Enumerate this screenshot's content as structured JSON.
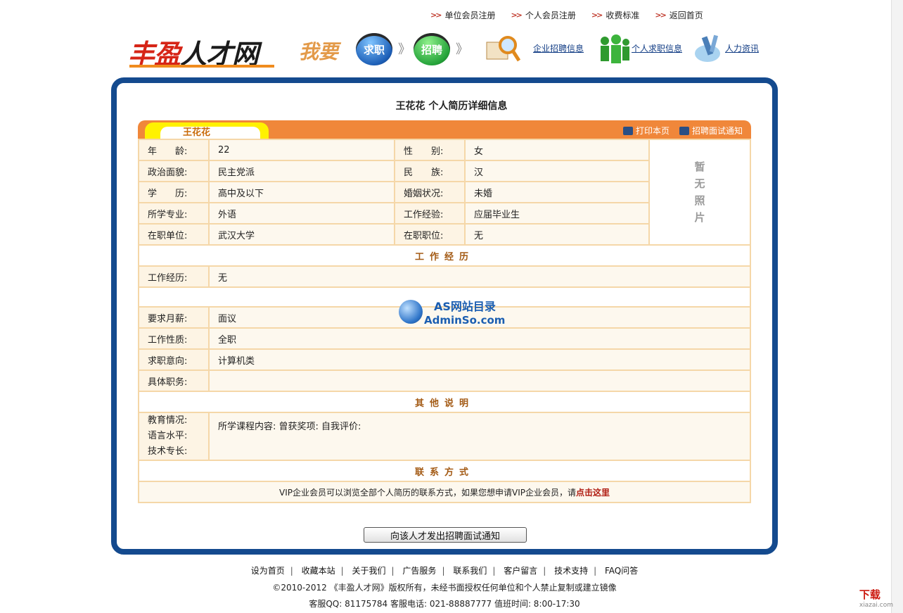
{
  "top_nav": [
    "单位会员注册",
    "个人会员注册",
    "收费标准",
    "返回首页"
  ],
  "logo": {
    "part1": "丰盈",
    "part2": "人才网"
  },
  "header": {
    "woyao": "我要",
    "qiuzhi": "求职",
    "zhaopin": "招聘",
    "links": [
      "企业招聘信息",
      "个人求职信息",
      "人力资讯"
    ]
  },
  "page_title": "王花花  个人简历详细信息",
  "resume": {
    "name_tab": "王花花",
    "print_label": "打印本页",
    "notify_label": "招聘面试通知",
    "basic": [
      {
        "l1": "年　　龄:",
        "v1": "22",
        "l2": "性　　别:",
        "v2": "女"
      },
      {
        "l1": "政治面貌:",
        "v1": "民主党派",
        "l2": "民　　族:",
        "v2": "汉"
      },
      {
        "l1": "学　　历:",
        "v1": "高中及以下",
        "l2": "婚姻状况:",
        "v2": "未婚"
      },
      {
        "l1": "所学专业:",
        "v1": "外语",
        "l2": "工作经验:",
        "v2": "应届毕业生"
      },
      {
        "l1": "在职单位:",
        "v1": "武汉大学",
        "l2": "在职职位:",
        "v2": "无"
      }
    ],
    "photo_text": [
      "暂",
      "无",
      "照",
      "片"
    ],
    "section_work": "工作经历",
    "work_label": "工作经历:",
    "work_value": "无",
    "job": [
      {
        "label": "要求月薪:",
        "value": "面议"
      },
      {
        "label": "工作性质:",
        "value": "全职"
      },
      {
        "label": "求职意向:",
        "value": "计算机类"
      },
      {
        "label": "具体职务:",
        "value": ""
      }
    ],
    "section_other": "其他说明",
    "other_labels": [
      "教育情况:",
      "语言水平:",
      "技术专长:"
    ],
    "other_value": "所学课程内容: 曾获奖项: 自我评价:",
    "section_contact": "联系方式",
    "contact_note": "VIP企业会员可以浏览全部个人简历的联系方式，如果您想申请VIP企业会员，请",
    "contact_link": "点击这里"
  },
  "watermark": {
    "line1": "AS网站目录",
    "line2": "AdminSo.com"
  },
  "send_button": "向该人才发出招聘面试通知",
  "footer": {
    "links": [
      "设为首页",
      "收藏本站",
      "关于我们",
      "广告服务",
      "联系我们",
      "客户留言",
      "技术支持",
      "FAQ问答"
    ],
    "copyright": "©2010-2012 《丰盈人才网》版权所有，未经书面授权任何单位和个人禁止复制或建立镜像",
    "contact": "客服QQ: 81175784   客服电话: 021-88887777   值班时间: 8:00-17:30"
  },
  "badge": {
    "main": "下载",
    "sub": "xiazai.com"
  },
  "colors": {
    "frame": "#144a8e",
    "bar": "#f0873a",
    "tab": "#fff200",
    "border": "#f5d7a8",
    "accent_red": "#d62416"
  }
}
